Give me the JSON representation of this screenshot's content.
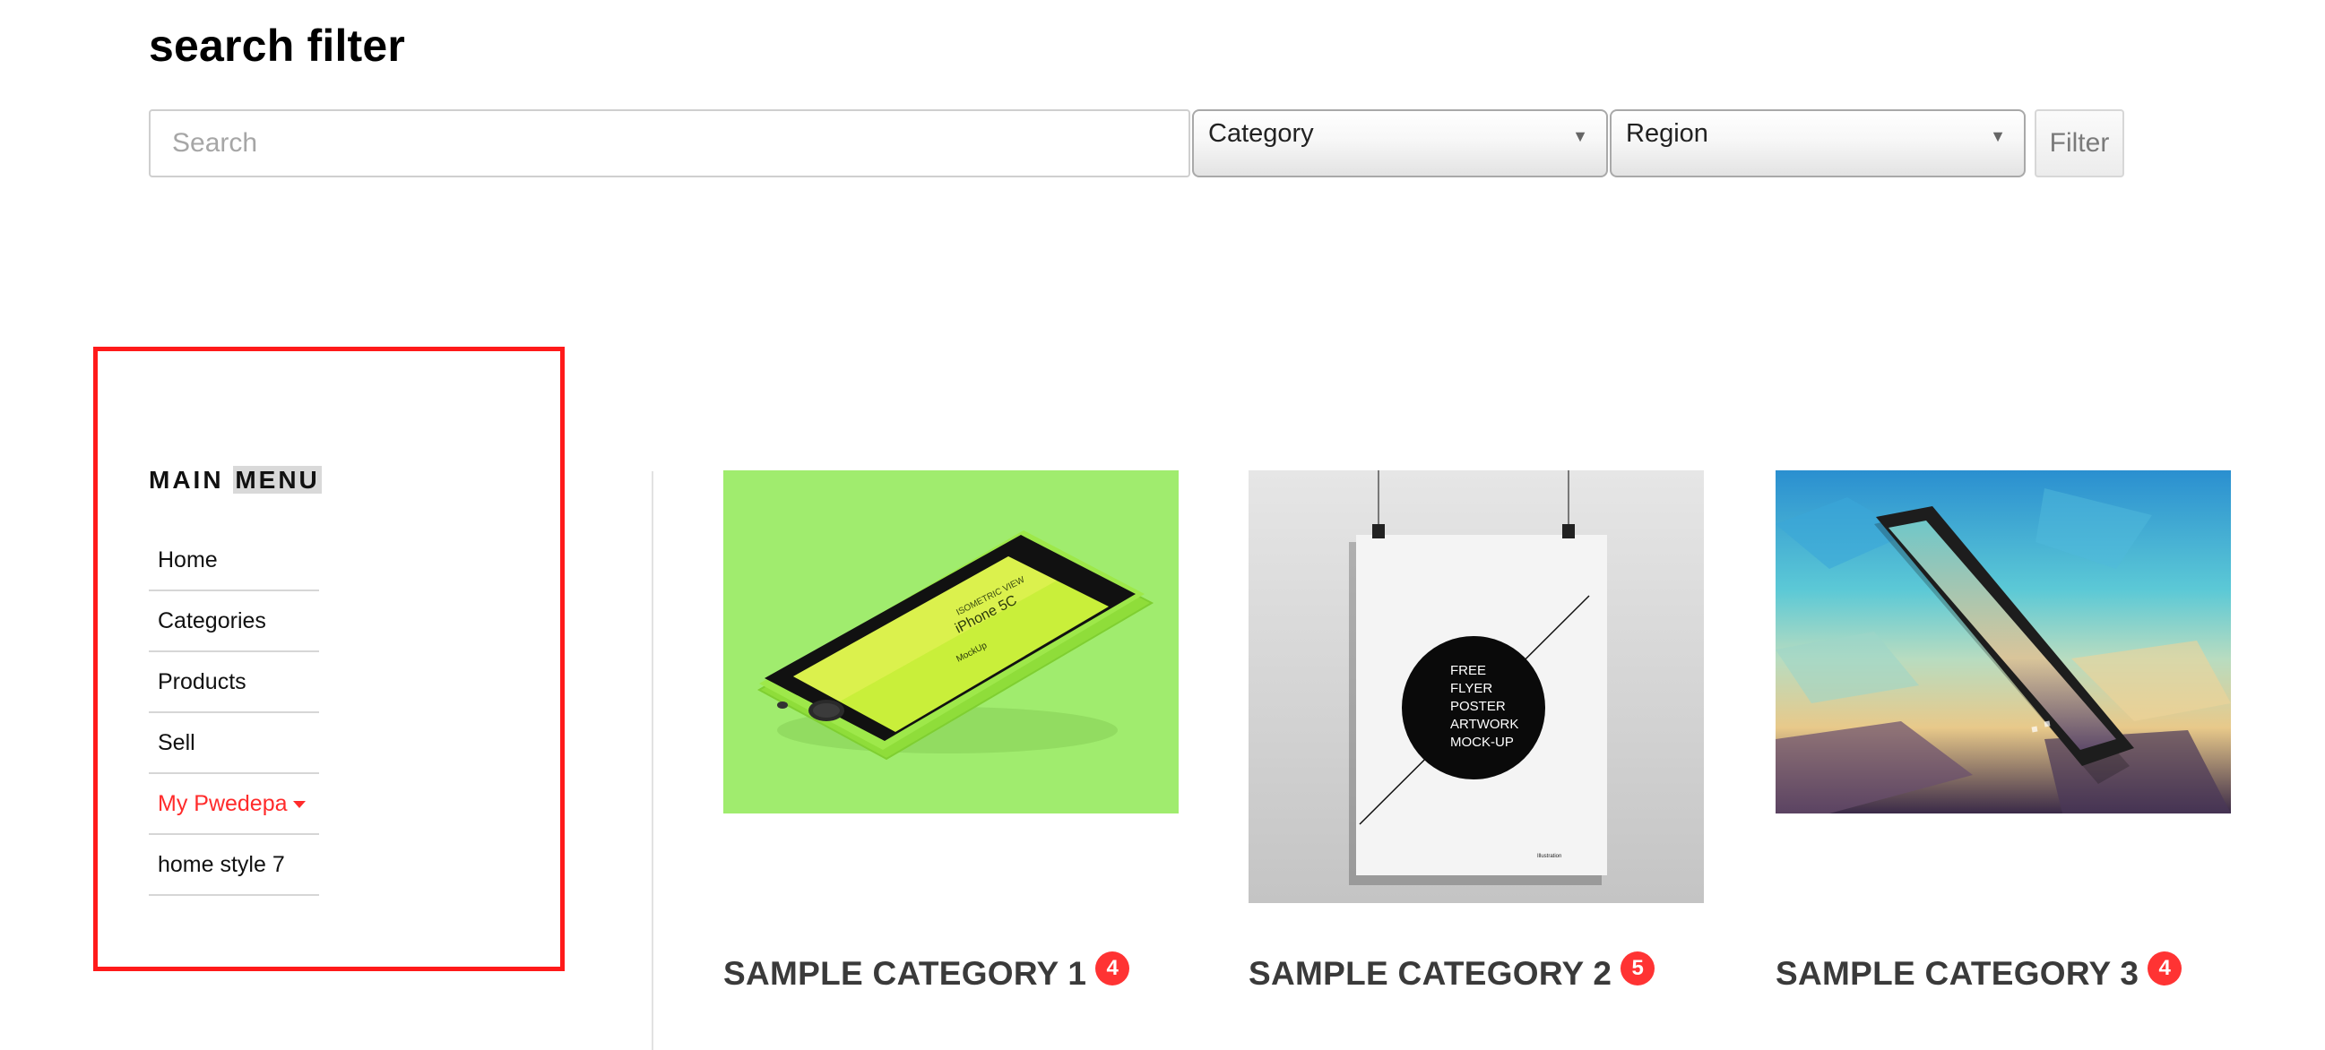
{
  "header": {
    "title": "search filter"
  },
  "filters": {
    "search_placeholder": "Search",
    "category_label": "Category",
    "region_label": "Region",
    "filter_button": "Filter"
  },
  "main_menu": {
    "title_part1": "MAIN",
    "title_part2": "MENU",
    "items": [
      {
        "label": "Home"
      },
      {
        "label": "Categories"
      },
      {
        "label": "Products"
      },
      {
        "label": "Sell"
      },
      {
        "label": "My Pwedepa"
      },
      {
        "label": "home style 7"
      }
    ]
  },
  "categories": [
    {
      "title": "SAMPLE CATEGORY 1",
      "count": "4",
      "image": {
        "line1": "ISOMETRIC VIEW",
        "line2": "iPhone 5C",
        "line3": "MockUp"
      }
    },
    {
      "title": "SAMPLE CATEGORY 2",
      "count": "5",
      "image": {
        "lines": [
          "FREE",
          "FLYER",
          "POSTER",
          "ARTWORK",
          "MOCK-UP"
        ],
        "footer": "Illustration"
      }
    },
    {
      "title": "SAMPLE CATEGORY 3",
      "count": "4",
      "image": {}
    }
  ],
  "colors": {
    "accent_red": "#ff2b2b",
    "badge_red": "#ff3333",
    "highlight_frame": "#ff1a1a",
    "green_bg": "#a0ec6e"
  }
}
